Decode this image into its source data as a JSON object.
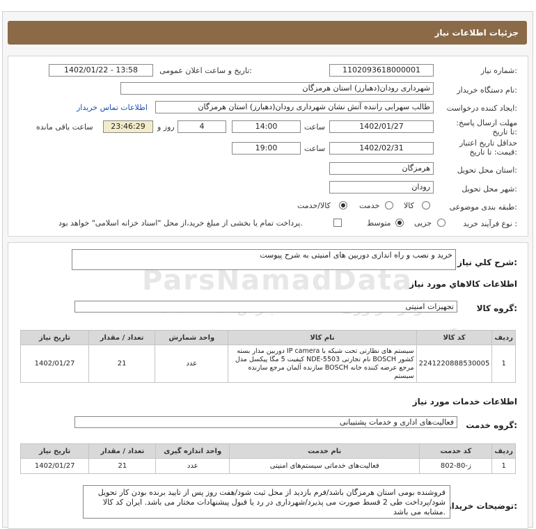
{
  "header": {
    "title": "جزئیات اطلاعات نیاز"
  },
  "form": {
    "need_number_label": "شماره نیاز:",
    "need_number": "1102093618000001",
    "announce_label": "تاریخ و ساعت اعلان عمومی:",
    "announce_value": "1402/01/22 - 13:58",
    "buyer_org_label": "نام دستگاه خریدار:",
    "buyer_org": "شهرداری رودان(دهبارز) استان هرمزگان",
    "creator_label": "ایجاد کننده درخواست:",
    "creator": "طالب سهرابی راننده آتش نشان شهرداری رودان(دهبارز) استان هرمزگان",
    "contact_link": "اطلاعات تماس خریدار",
    "deadline_label": "مهلت ارسال پاسخ: تا تاریخ:",
    "deadline_date": "1402/01/27",
    "time_label": "ساعت",
    "deadline_time": "14:00",
    "days_value": "4",
    "days_label": "روز و",
    "remaining_time": "23:46:29",
    "remaining_label": "ساعت باقی مانده",
    "validity_label": "حداقل تاریخ اعتبار قیمت: تا تاریخ:",
    "validity_date": "1402/02/31",
    "validity_time": "19:00",
    "province_label": "استان محل تحویل:",
    "province": "هرمزگان",
    "city_label": "شهر محل تحویل:",
    "city": "رودان",
    "category_label": "طبقه بندی موضوعی:",
    "category_options": [
      "کالا",
      "خدمت",
      "کالا/خدمت"
    ],
    "process_label": "نوع فرآیند خرید :",
    "process_options": [
      "جزیی",
      "متوسط"
    ],
    "payment_note": "پرداخت تمام یا بخشی از مبلغ خرید،از محل \"اسناد خزانه اسلامی\" خواهد بود."
  },
  "summary": {
    "label": "شرح کلي نياز:",
    "value": "خرید و نصب و راه اندازی دوربین های امنیتی به شرح پیوست"
  },
  "goods": {
    "section_title": "اطلاعات کالاهاي مورد نياز",
    "group_label": "گروه کالا:",
    "group_value": "تجهیزات امنیتی",
    "columns": [
      "ردیف",
      "کد کالا",
      "نام کالا",
      "واحد شمارش",
      "تعداد / مقدار",
      "تاریخ نیاز"
    ],
    "rows": [
      {
        "row": "1",
        "code": "2241220888530005",
        "name": "دوربین مدار بسته IP camera سیستم های نظارتی تحت شبکه با کیفیت 5 مگا پیکسل مدل NDE-5503 نام تجارتی BOSCH کشور سازنده آلمان مرجع سازنده BOSCH مرجع عرضه کننده خانه سیستم",
        "unit": "عدد",
        "qty": "21",
        "date": "1402/01/27"
      }
    ]
  },
  "services": {
    "section_title": "اطلاعات خدمات مورد نياز",
    "group_label": "گروه خدمت:",
    "group_value": "فعالیت‌های اداری و خدمات پشتیبانی",
    "columns": [
      "ردیف",
      "کد خدمت",
      "نام خدمت",
      "واحد اندازه گیری",
      "تعداد / مقدار",
      "تاریخ نیاز"
    ],
    "rows": [
      {
        "row": "1",
        "code": "ز-80-802",
        "name": "فعالیت‌های خدماتی سیستم‌های امنیتی",
        "unit": "عدد",
        "qty": "21",
        "date": "1402/01/27"
      }
    ]
  },
  "buyer_notes": {
    "label": "توضیحات خریدار:",
    "text": "فروشنده بومی استان هرمزگان باشد/فرم بازدید از محل ثبت شود/هفت روز پس از تایید برنده بودن کار تحویل شود/پرداخت طی 2 قسط صورت می پذیرد/شهرداری در رد یا قبول پیشنهادات مختار می باشد. ایران کد کالا مشابه می باشد."
  },
  "watermark": {
    "brand": "ParsNamadData",
    "line1": "مرکز فراوری اطلاعات پارس نماد داده ها",
    "line2": "پایگاه جامع اطلاع رسانی مناقصات و مزایده",
    "phone": "۰۲۱-۸۸۳۴۹۶۷۰"
  }
}
